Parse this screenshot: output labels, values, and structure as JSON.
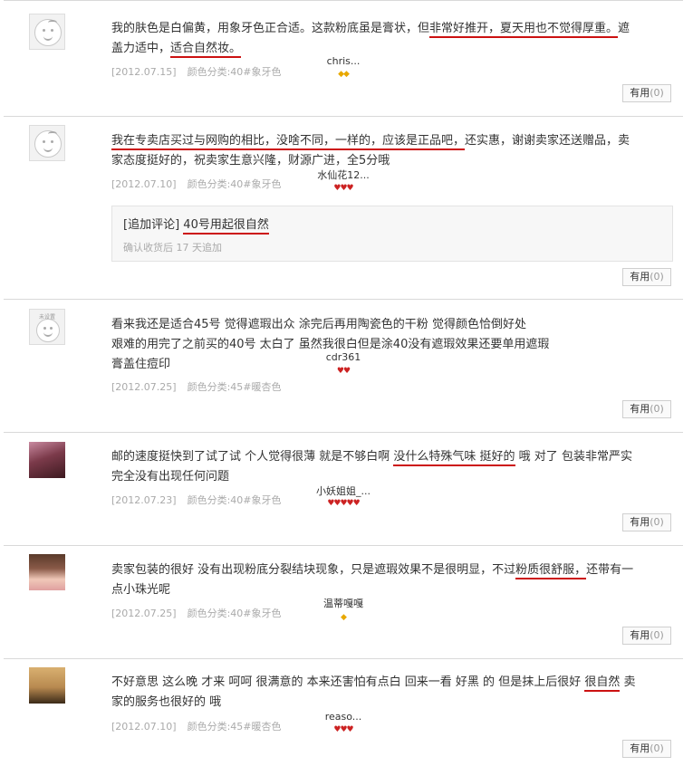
{
  "reviews": [
    {
      "user": "chris...",
      "avatar": "default-avatar",
      "badges": "◆◆",
      "text_a": "我的肤色是白偏黄，用象牙色正合适。这款粉底虽是膏状，但",
      "text_u1": "非常好推开，夏天用也不觉得厚重。",
      "text_b": "遮盖力适中，",
      "text_u2": "适合自然妆。",
      "date": "[2012.07.15]",
      "spec": "颜色分类:40#象牙色",
      "help_label": "有用",
      "help_count": "(0)"
    },
    {
      "user": "水仙花12...",
      "avatar": "default-avatar",
      "badges": "♥♥♥",
      "text_a": "我在专卖店买过与网购的相比，没啥不同，一样的，应该是正品吧，",
      "text_b": "还实惠，谢谢卖家还送赠品，卖家态度挺好的，祝卖家生意兴隆，财源广进，全5分哦",
      "date": "[2012.07.10]",
      "spec": "颜色分类:40#象牙色",
      "append_label": "[追加评论]",
      "append_text": "40号用起很自然",
      "append_sub": "确认收货后 17 天追加",
      "help_label": "有用",
      "help_count": "(0)"
    },
    {
      "user": "cdr361",
      "avatar": "default-avatar",
      "avatar_tag": "未设置",
      "badges": "♥♥",
      "text_a": "看来我还是适合45号 觉得遮瑕出众 涂完后再用陶瓷色的干粉 觉得颜色恰倒好处",
      "text_b": "艰难的用完了之前买的40号 太白了 虽然我很白但是涂40没有遮瑕效果还要单用遮瑕",
      "text_c": "膏盖住痘印",
      "date": "[2012.07.25]",
      "spec": "颜色分类:45#暖杏色",
      "help_label": "有用",
      "help_count": "(0)"
    },
    {
      "user": "小妖姐姐_...",
      "avatar": "user-photo-avatar",
      "badges": "♥♥♥♥♥",
      "text_a": "邮的速度挺快到了试了试 个人觉得很薄 就是不够白啊 ",
      "text_u1": "没什么特殊气味 挺好的",
      "text_b": " 哦 对了 包装非常严实完全没有出现任何问题",
      "date": "[2012.07.23]",
      "spec": "颜色分类:40#象牙色",
      "help_label": "有用",
      "help_count": "(0)"
    },
    {
      "user": "温蒂嘎嘎",
      "avatar": "user-photo-avatar",
      "badges": "◆",
      "text_a": "卖家包装的很好 没有出现粉底分裂结块现象，只是遮瑕效果不是很明显，不过",
      "text_u1": "粉质很舒服，",
      "text_b": "还带有一点小珠光呢",
      "date": "[2012.07.25]",
      "spec": "颜色分类:40#象牙色",
      "help_label": "有用",
      "help_count": "(0)"
    },
    {
      "user": "reaso...",
      "avatar": "user-photo-avatar",
      "badges": "♥♥♥",
      "text_a": "不好意思 这么晚 才来 呵呵 很满意的 本来还害怕有点白 回来一看 好黑 的 但是抹上后很好 ",
      "text_u1": "很自然",
      "text_b": " 卖家的服务也很好的 哦",
      "date": "[2012.07.10]",
      "spec": "颜色分类:45#暖杏色",
      "help_label": "有用",
      "help_count": "(0)"
    }
  ],
  "colors": {
    "underline": "#cc1111",
    "meta": "#aaaaaa",
    "diamond_red": "#cc2222",
    "diamond_yellow": "#e8a800"
  }
}
